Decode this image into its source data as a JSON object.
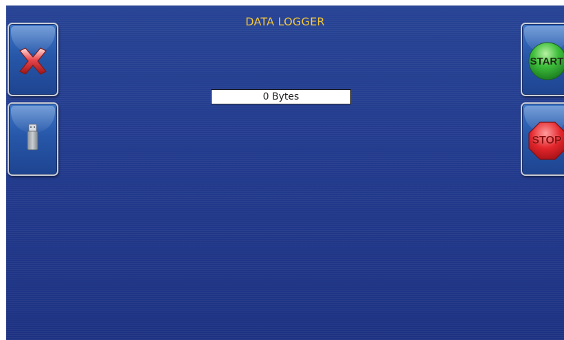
{
  "screen": {
    "title": "DATA LOGGER"
  },
  "logger": {
    "size_text": "0 Bytes"
  },
  "buttons": {
    "exit": {
      "icon": "close-x-icon"
    },
    "usb": {
      "icon": "usb-drive-icon"
    },
    "start": {
      "label": "START",
      "color": "#2fae3a"
    },
    "stop": {
      "label": "STOP",
      "color": "#d8232a"
    }
  },
  "colors": {
    "background": "#223a8c",
    "title": "#f2c63a",
    "button_face": "#2757a9"
  }
}
